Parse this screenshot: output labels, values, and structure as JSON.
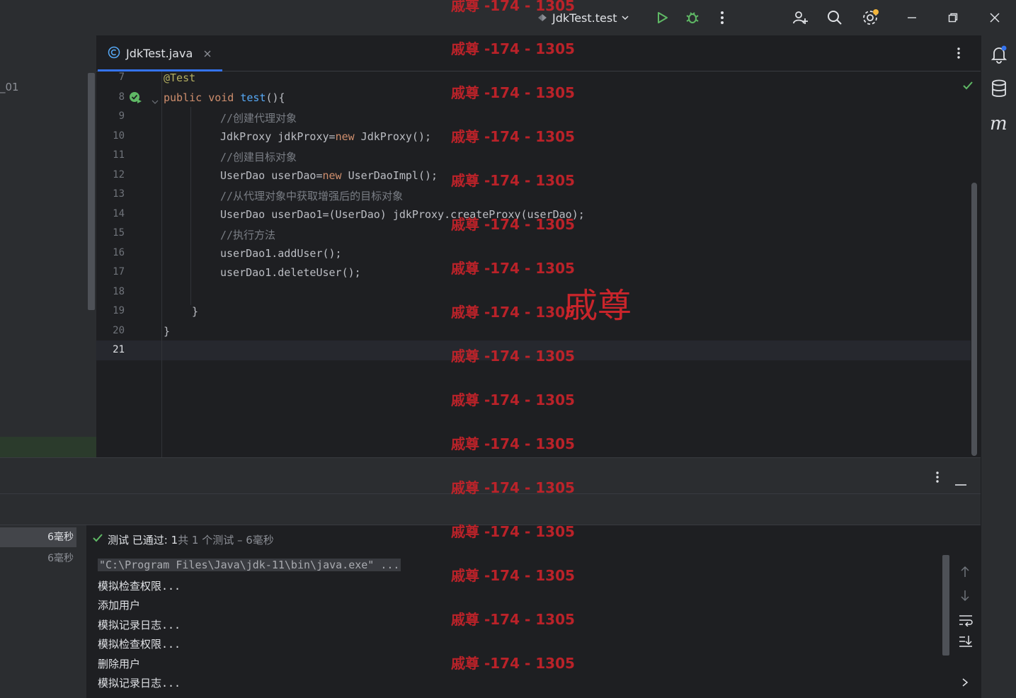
{
  "titlebar": {
    "run_config": "JdkTest.test"
  },
  "project": {
    "partial_name": "_01"
  },
  "tabs": [
    {
      "label": "JdkTest.java"
    }
  ],
  "editor": {
    "gutter": [
      "7",
      "8",
      "9",
      "10",
      "11",
      "12",
      "13",
      "14",
      "15",
      "16",
      "17",
      "18",
      "19",
      "20",
      "21"
    ],
    "lines": {
      "l7_ann": "@Test",
      "l8_kw": "public void ",
      "l8_fn": "test",
      "l8_rest": "(){",
      "l9": "//创建代理对象",
      "l10_a": "JdkProxy jdkProxy=",
      "l10_kw": "new",
      "l10_b": " JdkProxy();",
      "l11": "//创建目标对象",
      "l12_a": "UserDao userDao=",
      "l12_kw": "new",
      "l12_b": " UserDaoImpl();",
      "l13": "//从代理对象中获取增强后的目标对象",
      "l14": "UserDao userDao1=(UserDao) jdkProxy.createProxy(userDao);",
      "l15": "//执行方法",
      "l16": "userDao1.addUser();",
      "l17": "userDao1.deleteUser();",
      "l19": "}",
      "l20": "}"
    }
  },
  "run_panel": {
    "status_passed": "测试 已通过: 1",
    "status_detail": "共 1 个测试 – 6毫秒",
    "tree": [
      "6毫秒",
      "6毫秒"
    ],
    "console": [
      "\"C:\\Program Files\\Java\\jdk-11\\bin\\java.exe\" ...",
      "模拟检查权限...",
      "添加用户",
      "模拟记录日志...",
      "模拟检查权限...",
      "删除用户",
      "模拟记录日志..."
    ]
  },
  "watermark": {
    "repeat": "戚尊 -174 - 1305",
    "big": "戚尊"
  },
  "colors": {
    "accent": "#3574f0",
    "run_green": "#5fb865",
    "watermark_red": "#c8232a"
  }
}
